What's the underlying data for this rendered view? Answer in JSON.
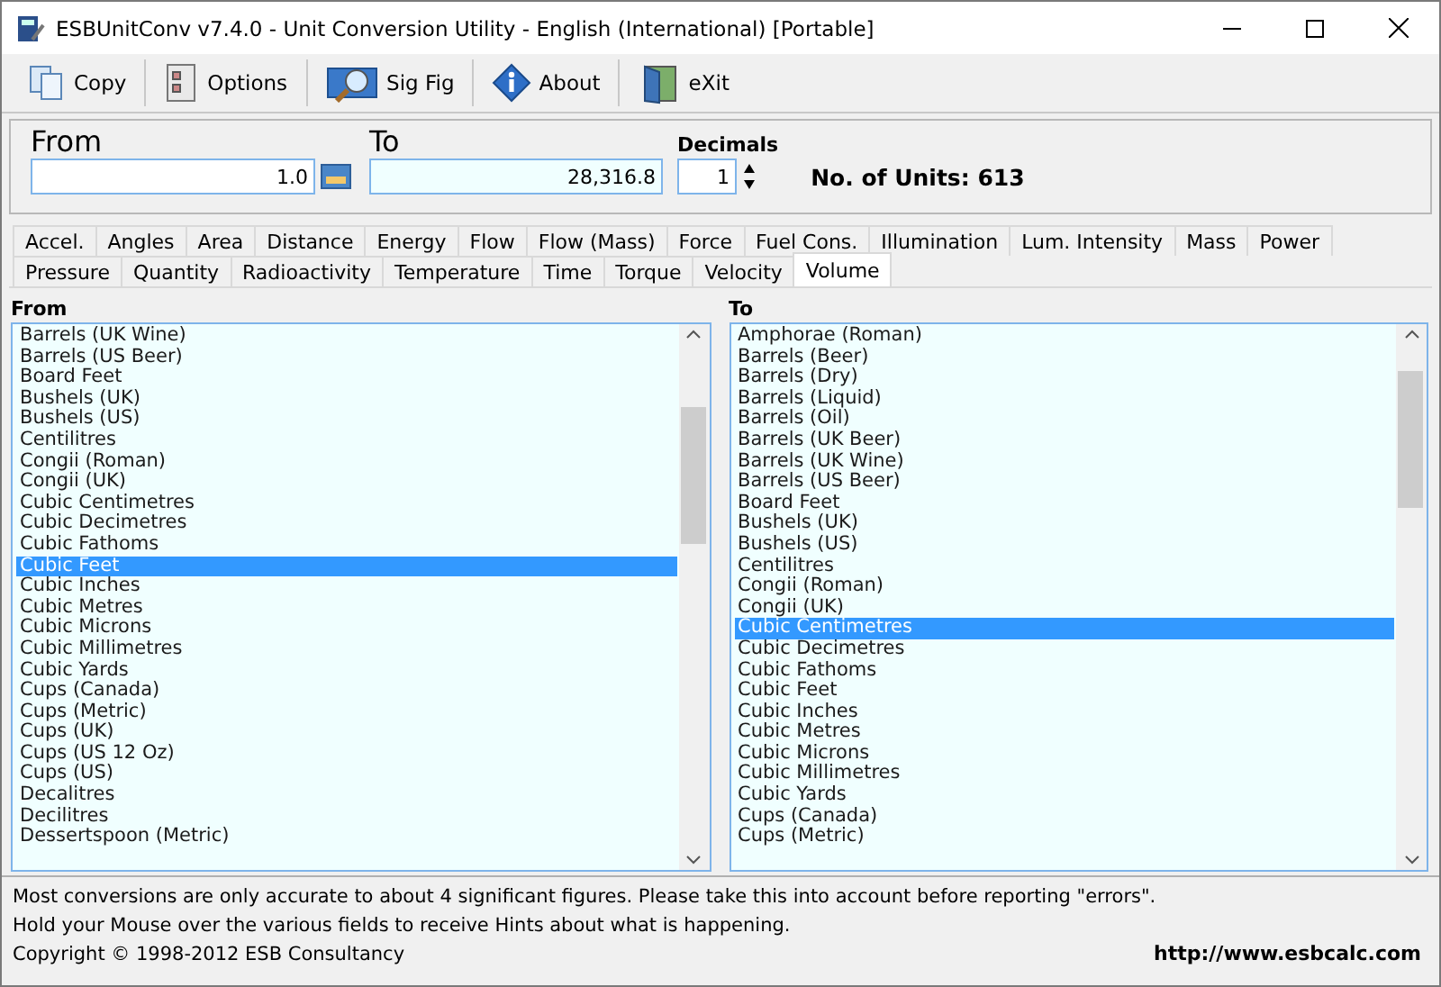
{
  "window": {
    "title": "ESBUnitConv v7.4.0 - Unit Conversion Utility - English (International) [Portable]"
  },
  "toolbar": [
    {
      "label": "Copy",
      "kind": "copy"
    },
    {
      "label": "Options",
      "kind": "options"
    },
    {
      "label": "Sig Fig",
      "kind": "sigfig"
    },
    {
      "label": "About",
      "kind": "about"
    },
    {
      "label": "eXit",
      "kind": "exit"
    }
  ],
  "from": {
    "label": "From",
    "value": "1.0"
  },
  "to": {
    "label": "To",
    "value": "28,316.8"
  },
  "decimals": {
    "label": "Decimals",
    "value": "1"
  },
  "unit_count": "No. of Units: 613",
  "tab_rows": [
    [
      {
        "label": "Accel.",
        "selected": false
      },
      {
        "label": "Angles",
        "selected": false
      },
      {
        "label": "Area",
        "selected": false
      },
      {
        "label": "Distance",
        "selected": false
      },
      {
        "label": "Energy",
        "selected": false
      },
      {
        "label": "Flow",
        "selected": false
      },
      {
        "label": "Flow (Mass)",
        "selected": false
      },
      {
        "label": "Force",
        "selected": false
      },
      {
        "label": "Fuel Cons.",
        "selected": false
      },
      {
        "label": "Illumination",
        "selected": false
      },
      {
        "label": "Lum. Intensity",
        "selected": false
      },
      {
        "label": "Mass",
        "selected": false
      },
      {
        "label": "Power",
        "selected": false
      }
    ],
    [
      {
        "label": "Pressure",
        "selected": false
      },
      {
        "label": "Quantity",
        "selected": false
      },
      {
        "label": "Radioactivity",
        "selected": false
      },
      {
        "label": "Temperature",
        "selected": false
      },
      {
        "label": "Time",
        "selected": false
      },
      {
        "label": "Torque",
        "selected": false
      },
      {
        "label": "Velocity",
        "selected": false
      },
      {
        "label": "Volume",
        "selected": true
      }
    ]
  ],
  "lists": [
    {
      "heading": "From",
      "items": [
        {
          "label": "Barrels (UK Wine)",
          "selected": false
        },
        {
          "label": "Barrels (US Beer)",
          "selected": false
        },
        {
          "label": "Board Feet",
          "selected": false
        },
        {
          "label": "Bushels (UK)",
          "selected": false
        },
        {
          "label": "Bushels (US)",
          "selected": false
        },
        {
          "label": "Centilitres",
          "selected": false
        },
        {
          "label": "Congii (Roman)",
          "selected": false
        },
        {
          "label": "Congii (UK)",
          "selected": false
        },
        {
          "label": "Cubic Centimetres",
          "selected": false
        },
        {
          "label": "Cubic Decimetres",
          "selected": false
        },
        {
          "label": "Cubic Fathoms",
          "selected": false
        },
        {
          "label": "Cubic Feet",
          "selected": true
        },
        {
          "label": "Cubic Inches",
          "selected": false
        },
        {
          "label": "Cubic Metres",
          "selected": false
        },
        {
          "label": "Cubic Microns",
          "selected": false
        },
        {
          "label": "Cubic Millimetres",
          "selected": false
        },
        {
          "label": "Cubic Yards",
          "selected": false
        },
        {
          "label": "Cups (Canada)",
          "selected": false
        },
        {
          "label": "Cups (Metric)",
          "selected": false
        },
        {
          "label": "Cups (UK)",
          "selected": false
        },
        {
          "label": "Cups (US 12 Oz)",
          "selected": false
        },
        {
          "label": "Cups (US)",
          "selected": false
        },
        {
          "label": "Decalitres",
          "selected": false
        },
        {
          "label": "Decilitres",
          "selected": false
        },
        {
          "label": "Dessertspoon (Metric)",
          "selected": false
        }
      ]
    },
    {
      "heading": "To",
      "items": [
        {
          "label": "Amphorae (Roman)",
          "selected": false
        },
        {
          "label": "Barrels (Beer)",
          "selected": false
        },
        {
          "label": "Barrels (Dry)",
          "selected": false
        },
        {
          "label": "Barrels (Liquid)",
          "selected": false
        },
        {
          "label": "Barrels (Oil)",
          "selected": false
        },
        {
          "label": "Barrels (UK Beer)",
          "selected": false
        },
        {
          "label": "Barrels (UK Wine)",
          "selected": false
        },
        {
          "label": "Barrels (US Beer)",
          "selected": false
        },
        {
          "label": "Board Feet",
          "selected": false
        },
        {
          "label": "Bushels (UK)",
          "selected": false
        },
        {
          "label": "Bushels (US)",
          "selected": false
        },
        {
          "label": "Centilitres",
          "selected": false
        },
        {
          "label": "Congii (Roman)",
          "selected": false
        },
        {
          "label": "Congii (UK)",
          "selected": false
        },
        {
          "label": "Cubic Centimetres",
          "selected": true
        },
        {
          "label": "Cubic Decimetres",
          "selected": false
        },
        {
          "label": "Cubic Fathoms",
          "selected": false
        },
        {
          "label": "Cubic Feet",
          "selected": false
        },
        {
          "label": "Cubic Inches",
          "selected": false
        },
        {
          "label": "Cubic Metres",
          "selected": false
        },
        {
          "label": "Cubic Microns",
          "selected": false
        },
        {
          "label": "Cubic Millimetres",
          "selected": false
        },
        {
          "label": "Cubic Yards",
          "selected": false
        },
        {
          "label": "Cups (Canada)",
          "selected": false
        },
        {
          "label": "Cups (Metric)",
          "selected": false
        }
      ]
    }
  ],
  "status": {
    "lines": [
      "Most conversions are only accurate to about 4 significant figures. Please take this into account before reporting \"errors\".",
      "Hold your Mouse over the various fields to receive Hints about what is happening."
    ],
    "copyright": "Copyright © 1998-2012 ESB Consultancy",
    "url": "http://www.esbcalc.com"
  }
}
